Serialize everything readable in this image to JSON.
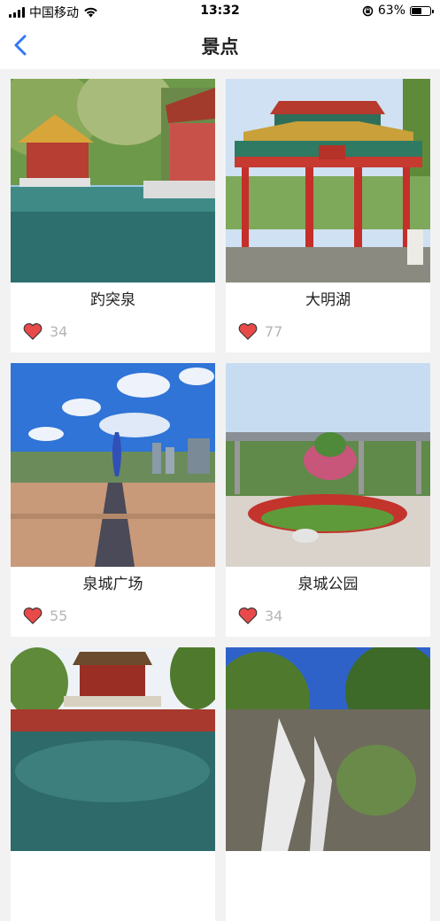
{
  "status": {
    "carrier": "中国移动",
    "time": "13:32",
    "battery_percent": "63%",
    "battery_level": 0.63
  },
  "nav": {
    "title": "景点",
    "back_icon": "chevron-left-icon",
    "accent": "#3478f6"
  },
  "spots": [
    {
      "name": "趵突泉",
      "likes": "34"
    },
    {
      "name": "大明湖",
      "likes": "77"
    },
    {
      "name": "泉城广场",
      "likes": "55"
    },
    {
      "name": "泉城公园",
      "likes": "34"
    },
    {
      "name": "",
      "likes": ""
    },
    {
      "name": "",
      "likes": ""
    }
  ],
  "heart_color": "#e84a4a"
}
